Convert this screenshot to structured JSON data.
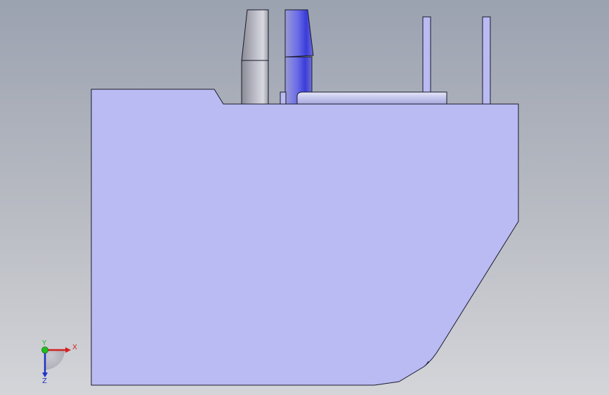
{
  "viewport": {
    "background_top": "#9ba2b0",
    "background_bottom": "#d4d5d9"
  },
  "model": {
    "body_fill": "#babbf3",
    "edge_color": "#1a1a2a",
    "gray_component_fill": "#a8a9b3",
    "selected_component_fill": "#5a5ce0"
  },
  "triad": {
    "x_label": "X",
    "y_label": "Y",
    "z_label": "Z",
    "x_color": "#d42020",
    "y_color": "#20c020",
    "z_color": "#2030c8"
  }
}
